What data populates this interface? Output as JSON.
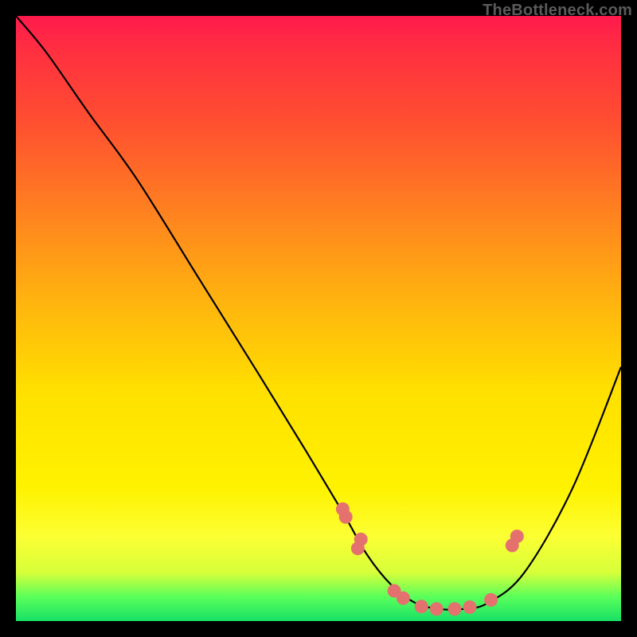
{
  "watermark": "TheBottleneck.com",
  "chart_data": {
    "type": "line",
    "title": "",
    "xlabel": "",
    "ylabel": "",
    "xlim": [
      0,
      100
    ],
    "ylim": [
      0,
      100
    ],
    "series": [
      {
        "name": "curve",
        "x": [
          0,
          5,
          12,
          20,
          30,
          40,
          48,
          54,
          58,
          62,
          66,
          70,
          74,
          78,
          84,
          92,
          100
        ],
        "y": [
          100,
          94,
          84,
          73,
          57,
          41,
          28,
          18,
          11,
          6,
          3,
          2,
          2,
          3,
          8,
          22,
          42
        ]
      }
    ],
    "markers": {
      "name": "dots",
      "color": "#e4716e",
      "x": [
        54.0,
        54.5,
        56.5,
        57.0,
        62.5,
        64.0,
        67.0,
        69.5,
        72.5,
        75.0,
        78.5,
        82.0,
        82.8
      ],
      "y": [
        18.5,
        17.2,
        12.0,
        13.5,
        5.0,
        3.8,
        2.4,
        2.0,
        2.0,
        2.3,
        3.5,
        12.5,
        14.0
      ]
    }
  }
}
